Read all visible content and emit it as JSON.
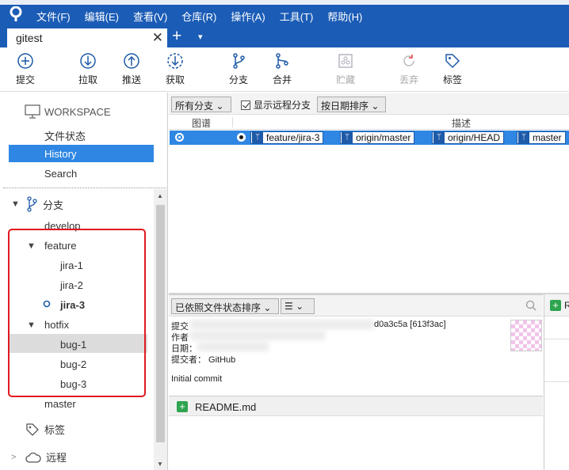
{
  "menubar": {
    "items": [
      "文件(F)",
      "编辑(E)",
      "查看(V)",
      "仓库(R)",
      "操作(A)",
      "工具(T)",
      "帮助(H)"
    ]
  },
  "tab": {
    "title": "gitest",
    "close": "✕",
    "add": "+",
    "menu": "▾"
  },
  "toolbar": {
    "commit": "提交",
    "pull": "拉取",
    "push": "推送",
    "fetch": "获取",
    "branch": "分支",
    "merge": "合并",
    "stash": "贮藏",
    "discard": "丢弃",
    "tag": "标签"
  },
  "sidebar": {
    "workspace": "WORKSPACE",
    "file_status": "文件状态",
    "history": "History",
    "search": "Search",
    "branches": "分支",
    "develop": "develop",
    "feature": "feature",
    "jira1": "jira-1",
    "jira2": "jira-2",
    "jira3": "jira-3",
    "hotfix": "hotfix",
    "bug1": "bug-1",
    "bug2": "bug-2",
    "bug3": "bug-3",
    "master": "master",
    "tags": "标签",
    "remotes": "远程"
  },
  "graph": {
    "branch_filter": "所有分支",
    "show_remote": "显示远程分支",
    "show_remote_checked": true,
    "sort": "按日期排序",
    "col_graph": "图谱",
    "col_desc": "描述",
    "refs": [
      "feature/jira-3",
      "origin/master",
      "origin/HEAD",
      "master"
    ]
  },
  "details": {
    "sort": "已依照文件状态排序",
    "commit_label": "提交",
    "commit_hash": "d0a3c5a [613f3ac]",
    "author_label": "作者",
    "date_label": "日期：",
    "committer_line": "提交者： GitHub",
    "message": "Initial commit",
    "file": "README.md"
  },
  "colors": {
    "accent": "#1b5cb6",
    "selection": "#2f87e3",
    "highlight_box": "#e0191f"
  }
}
